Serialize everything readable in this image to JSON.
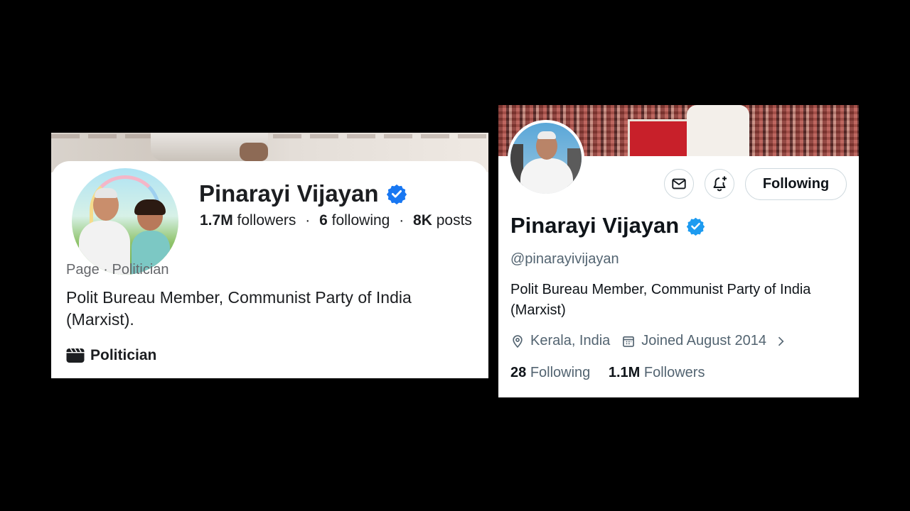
{
  "facebook": {
    "name": "Pinarayi Vijayan",
    "followers_count": "1.7M",
    "followers_label": "followers",
    "following_count": "6",
    "following_label": "following",
    "posts_count": "8K",
    "posts_label": "posts",
    "separator": "·",
    "category": "Page · Politician",
    "bio": "Polit Bureau Member, Communist Party of India (Marxist).",
    "tag": "Politician",
    "verified_color": "#1877f2"
  },
  "twitter": {
    "name": "Pinarayi Vijayan",
    "handle": "@pinarayivijayan",
    "follow_button": "Following",
    "bio": "Polit Bureau Member, Communist Party of India (Marxist)",
    "location": "Kerala, India",
    "joined": "Joined August 2014",
    "following_count": "28",
    "following_label": "Following",
    "followers_count": "1.1M",
    "followers_label": "Followers",
    "verified_color": "#1d9bf0"
  }
}
